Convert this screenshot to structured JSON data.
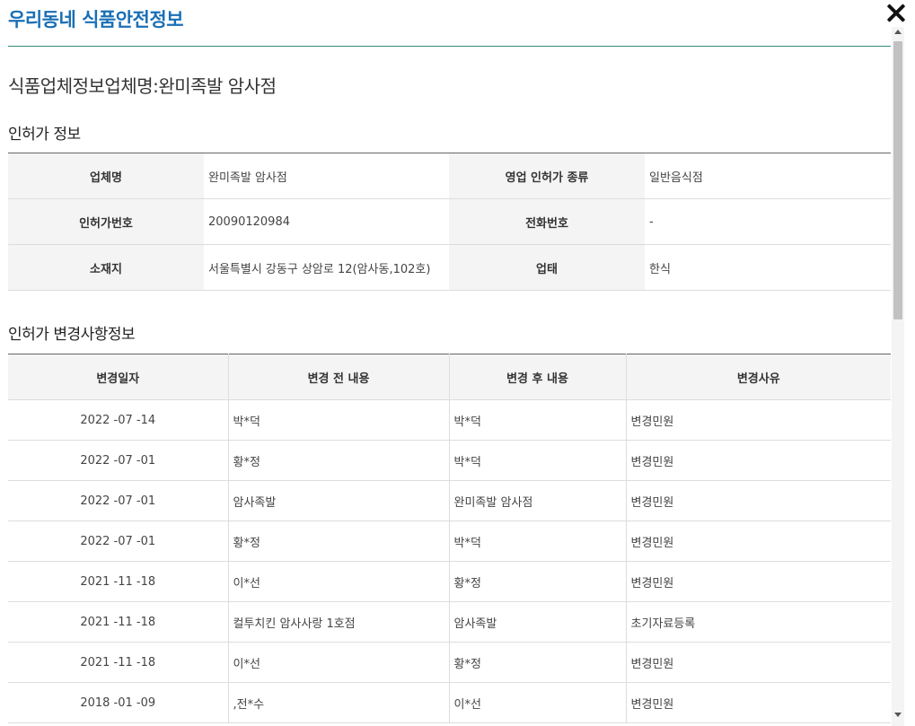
{
  "header": {
    "title": "우리동네 식품안전정보"
  },
  "business_title": "식품업체정보업체명:완미족발 암사점",
  "sections": {
    "license_info": "인허가 정보",
    "license_changes": "인허가 변경사항정보"
  },
  "license_info": {
    "rows": [
      [
        {
          "label": "업체명",
          "value": "완미족발 암사점"
        },
        {
          "label": "영업 인허가 종류",
          "value": "일반음식점"
        }
      ],
      [
        {
          "label": "인허가번호",
          "value": "20090120984"
        },
        {
          "label": "전화번호",
          "value": "-"
        }
      ],
      [
        {
          "label": "소재지",
          "value": "서울특별시 강동구 상암로 12(암사동,102호)"
        },
        {
          "label": "업태",
          "value": "한식"
        }
      ]
    ]
  },
  "license_changes": {
    "headers": [
      "변경일자",
      "변경 전 내용",
      "변경 후 내용",
      "변경사유"
    ],
    "rows": [
      [
        "2022 -07 -14",
        "박*덕",
        "박*덕",
        "변경민원"
      ],
      [
        "2022 -07 -01",
        "황*정",
        "박*덕",
        "변경민원"
      ],
      [
        "2022 -07 -01",
        "암사족발",
        "완미족발 암사점",
        "변경민원"
      ],
      [
        "2022 -07 -01",
        "황*정",
        "박*덕",
        "변경민원"
      ],
      [
        "2021 -11 -18",
        "이*선",
        "황*정",
        "변경민원"
      ],
      [
        "2021 -11 -18",
        "컬투치킨 암사사랑 1호점",
        "암사족발",
        "초기자료등록"
      ],
      [
        "2021 -11 -18",
        "이*선",
        "황*정",
        "변경민원"
      ],
      [
        "2018 -01 -09",
        ",전*수",
        "이*선",
        "변경민원"
      ]
    ]
  },
  "colors": {
    "title_blue": "#1a6fb5",
    "divider_teal": "#2f8a7a",
    "label_bg": "#f4f4f4"
  }
}
